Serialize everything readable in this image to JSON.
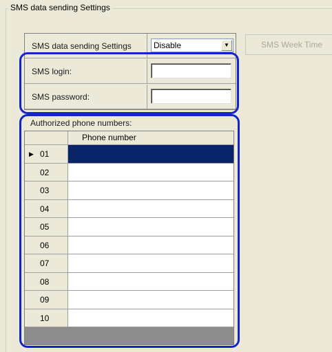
{
  "groupbox": {
    "title": "SMS data sending Settings"
  },
  "settings": {
    "mode_label": "SMS data sending Settings",
    "mode_value": "Disable",
    "login_label": "SMS login:",
    "login_value": "",
    "password_label": "SMS password:",
    "password_value": ""
  },
  "week_button_label": "SMS Week Time",
  "phones": {
    "label": "Authorized phone numbers:",
    "column_header": "Phone number",
    "rows": [
      {
        "num": "01",
        "value": "",
        "current": true
      },
      {
        "num": "02",
        "value": ""
      },
      {
        "num": "03",
        "value": ""
      },
      {
        "num": "04",
        "value": ""
      },
      {
        "num": "05",
        "value": ""
      },
      {
        "num": "06",
        "value": ""
      },
      {
        "num": "07",
        "value": ""
      },
      {
        "num": "08",
        "value": ""
      },
      {
        "num": "09",
        "value": ""
      },
      {
        "num": "10",
        "value": ""
      }
    ]
  },
  "colors": {
    "highlight": "#1424c8",
    "selection": "#0a246a",
    "window_bg": "#ece9d8"
  }
}
